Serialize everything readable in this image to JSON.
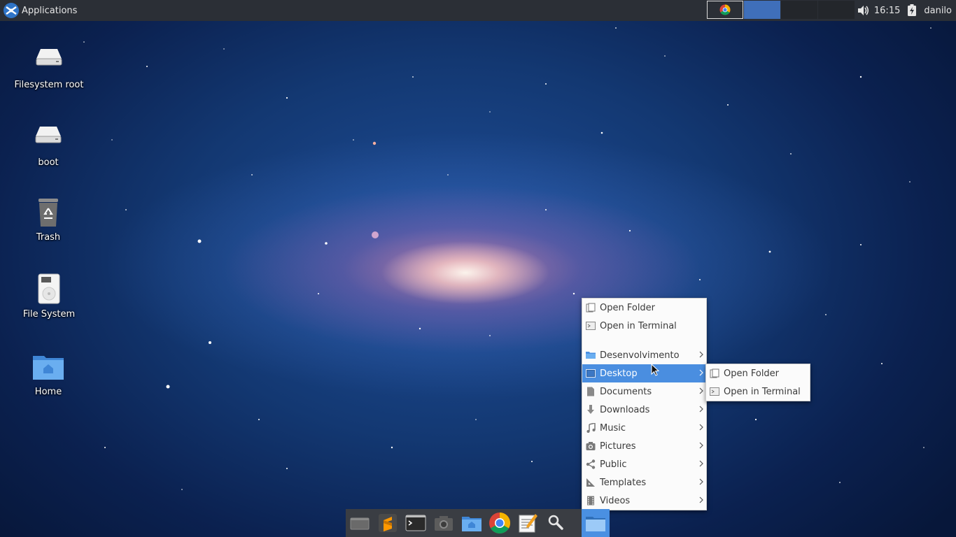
{
  "panel": {
    "applications_label": "Applications",
    "clock": "16:15",
    "user": "danilo"
  },
  "desktop": {
    "icons": [
      {
        "label": "Filesystem root",
        "icon": "drive-icon"
      },
      {
        "label": "boot",
        "icon": "drive-icon"
      },
      {
        "label": "Trash",
        "icon": "trash-icon"
      },
      {
        "label": "File System",
        "icon": "harddisk-icon"
      },
      {
        "label": "Home",
        "icon": "home-folder-icon"
      }
    ]
  },
  "context_menu": {
    "top_items": [
      {
        "label": "Open Folder",
        "icon": "open-folder-icon"
      },
      {
        "label": "Open in Terminal",
        "icon": "terminal-icon"
      }
    ],
    "folders": [
      {
        "label": "Desenvolvimento",
        "icon": "folder-icon"
      },
      {
        "label": "Desktop",
        "icon": "desktop-folder-icon",
        "highlighted": true
      },
      {
        "label": "Documents",
        "icon": "documents-icon"
      },
      {
        "label": "Downloads",
        "icon": "downloads-icon"
      },
      {
        "label": "Music",
        "icon": "music-icon"
      },
      {
        "label": "Pictures",
        "icon": "camera-icon"
      },
      {
        "label": "Public",
        "icon": "share-icon"
      },
      {
        "label": "Templates",
        "icon": "templates-icon"
      },
      {
        "label": "Videos",
        "icon": "film-icon"
      }
    ]
  },
  "submenu": {
    "items": [
      {
        "label": "Open Folder",
        "icon": "open-folder-icon"
      },
      {
        "label": "Open in Terminal",
        "icon": "terminal-icon"
      }
    ]
  },
  "dock": {
    "items": [
      "file-manager-icon",
      "sublime-text-icon",
      "terminal-icon",
      "screenshot-icon",
      "home-folder-icon",
      "chrome-icon",
      "text-editor-icon",
      "search-icon",
      "folder-icon"
    ]
  },
  "colors": {
    "panel_bg": "#2b2f36",
    "menu_highlight": "#4a8ee0",
    "active_task": "#3f6fba"
  }
}
